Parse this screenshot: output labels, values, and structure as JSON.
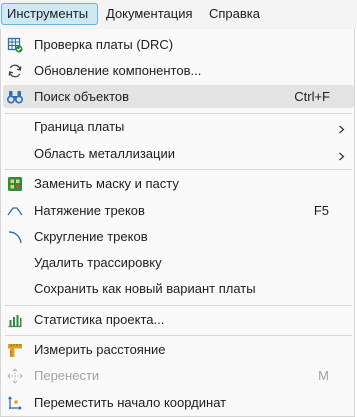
{
  "menubar": {
    "items": [
      {
        "label": "Инструменты",
        "active": true
      },
      {
        "label": "Документация",
        "active": false
      },
      {
        "label": "Справка",
        "active": false
      }
    ]
  },
  "menu": {
    "items": [
      {
        "label": "Проверка платы (DRC)",
        "shortcut": "",
        "icon": "drc-check-icon"
      },
      {
        "label": "Обновление компонентов...",
        "shortcut": "",
        "icon": "refresh-icon"
      },
      {
        "label": "Поиск объектов",
        "shortcut": "Ctrl+F",
        "icon": "binoculars-icon"
      },
      {
        "label": "Граница платы",
        "shortcut": "",
        "icon": "",
        "submenu": true
      },
      {
        "label": "Область металлизации",
        "shortcut": "",
        "icon": "",
        "submenu": true
      },
      {
        "label": "Заменить маску и пасту",
        "shortcut": "",
        "icon": "mask-paste-icon"
      },
      {
        "label": "Натяжение треков",
        "shortcut": "F5",
        "icon": "track-tension-icon"
      },
      {
        "label": "Скругление треков",
        "shortcut": "",
        "icon": "track-rounding-icon"
      },
      {
        "label": "Удалить трассировку",
        "shortcut": "",
        "icon": ""
      },
      {
        "label": "Сохранить как новый вариант платы",
        "shortcut": "",
        "icon": ""
      },
      {
        "label": "Статистика проекта...",
        "shortcut": "",
        "icon": "bar-chart-icon"
      },
      {
        "label": "Измерить расстояние",
        "shortcut": "",
        "icon": "ruler-icon"
      },
      {
        "label": "Перенести",
        "shortcut": "M",
        "icon": "move-icon",
        "disabled": true
      },
      {
        "label": "Переместить начало координат",
        "shortcut": "",
        "icon": "origin-icon"
      }
    ]
  },
  "colors": {
    "accent": "#6ab2d9",
    "hover": "#e3e3e3",
    "icon_blue": "#2f6db5",
    "icon_green": "#2e8b3e",
    "icon_yellow": "#d9a521",
    "disabled": "#a3a3a3"
  }
}
